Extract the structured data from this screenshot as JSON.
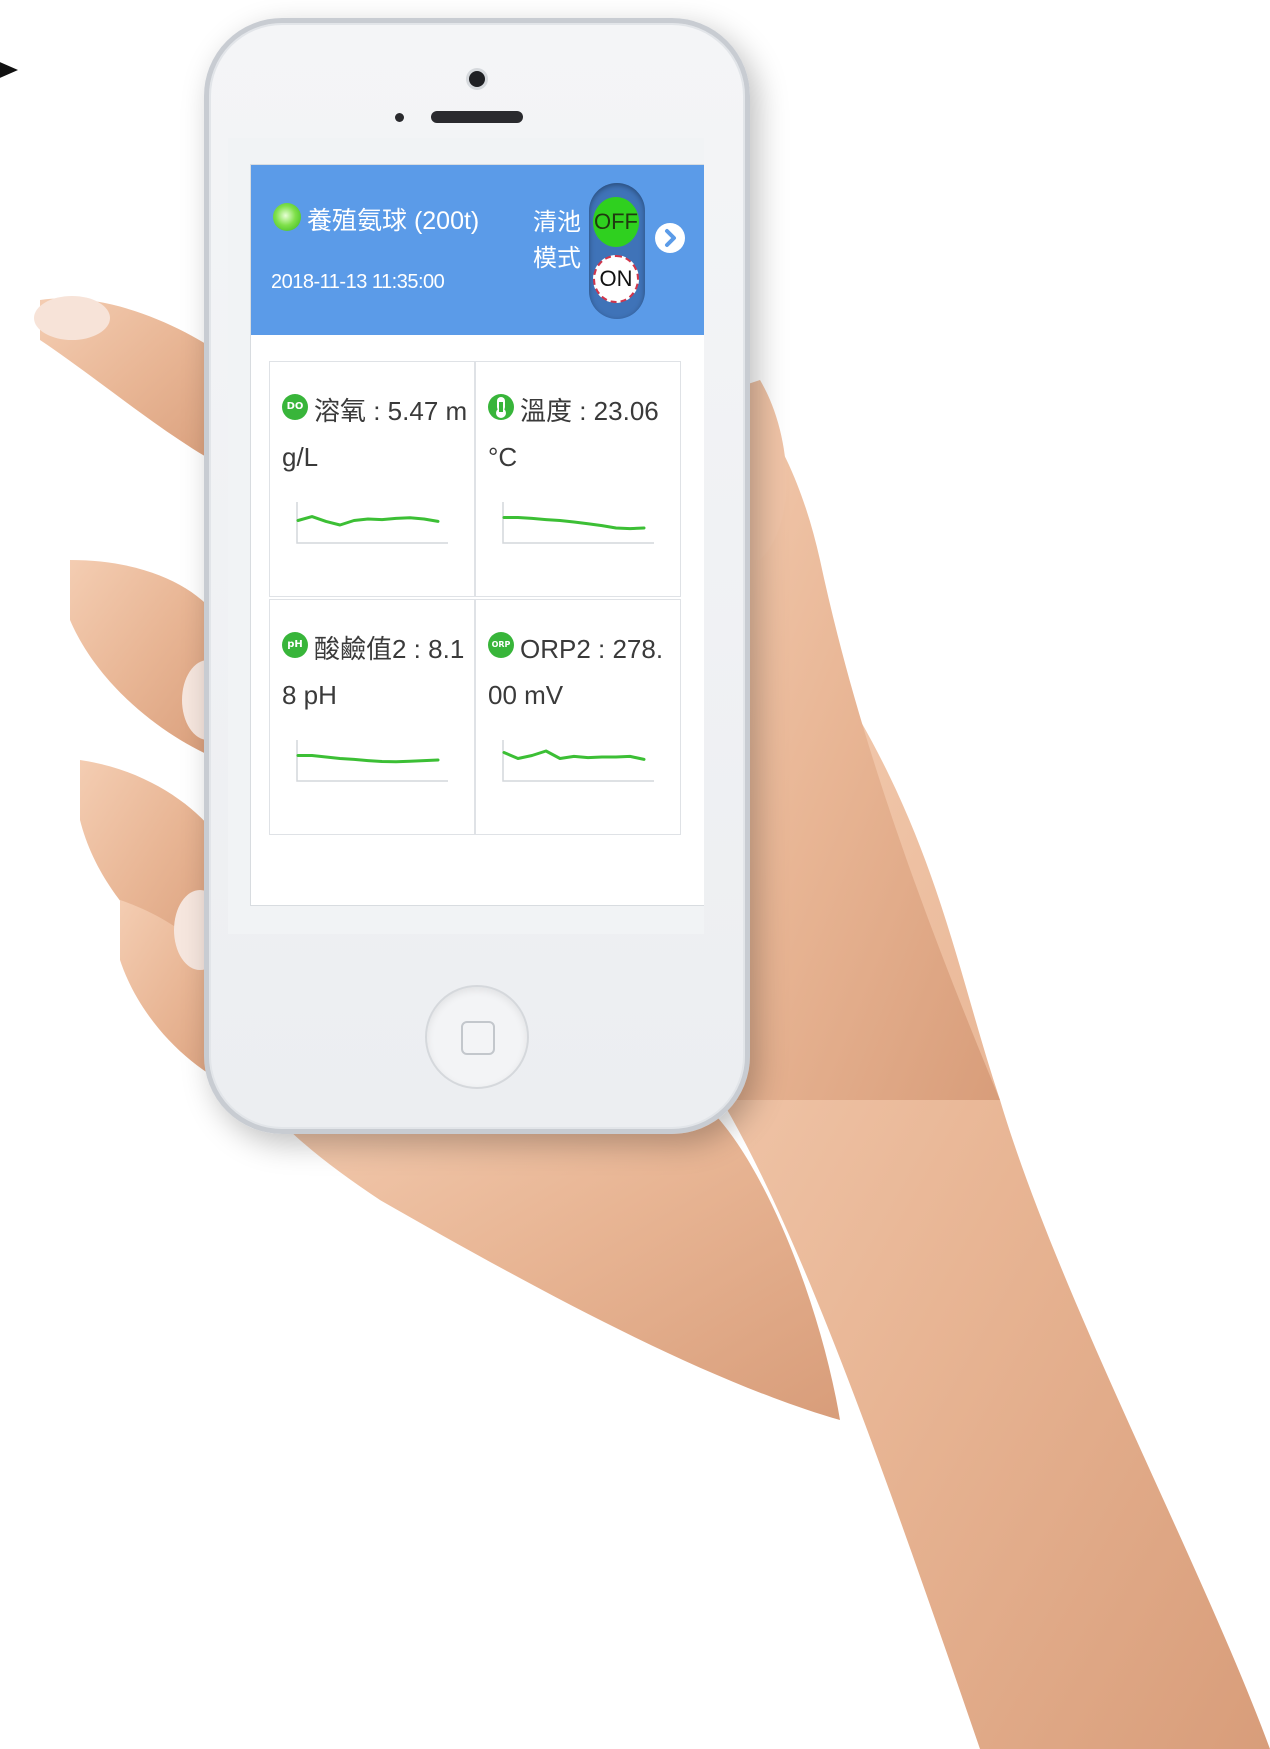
{
  "header": {
    "pond_name": "養殖氨球 (200t)",
    "timestamp": "2018-11-13 11:35:00",
    "clean_mode_label": "清池模式",
    "toggle_off_label": "OFF",
    "toggle_on_label": "ON"
  },
  "sensors": [
    {
      "icon": "DO",
      "label": "溶氧 : 5.47 mg/L",
      "trend": [
        0.55,
        0.42,
        0.58,
        0.7,
        0.55,
        0.5,
        0.52,
        0.48,
        0.46,
        0.5,
        0.58
      ]
    },
    {
      "icon": "temp",
      "label": "溫度 : 23.06 °C",
      "trend": [
        0.45,
        0.45,
        0.48,
        0.52,
        0.55,
        0.6,
        0.66,
        0.72,
        0.8,
        0.82,
        0.8
      ]
    },
    {
      "icon": "pH",
      "label": "酸鹼值2 : 8.18 pH",
      "trend": [
        0.45,
        0.45,
        0.5,
        0.55,
        0.58,
        0.62,
        0.65,
        0.66,
        0.64,
        0.62,
        0.6
      ]
    },
    {
      "icon": "ORP",
      "label": "ORP2 : 278.00 mV",
      "trend": [
        0.35,
        0.55,
        0.45,
        0.3,
        0.55,
        0.48,
        0.52,
        0.5,
        0.5,
        0.48,
        0.58
      ]
    }
  ],
  "colors": {
    "header_bg": "#5b9be8",
    "accent_green": "#38b53a",
    "sparkline": "#3cbf35"
  }
}
